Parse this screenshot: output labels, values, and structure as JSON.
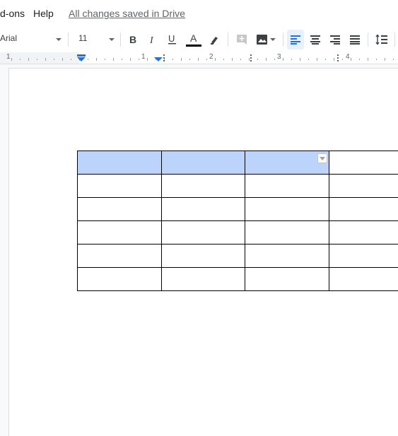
{
  "menu": {
    "items": [
      "d-ons",
      "Help"
    ],
    "save_status": "All changes saved in Drive"
  },
  "toolbar": {
    "font_name": "Arial",
    "font_size": "11",
    "text_color": "#000000",
    "icons": [
      "bold-icon",
      "italic-icon",
      "underline-icon",
      "text-color-icon",
      "highlight-icon",
      "insert-comment-icon",
      "insert-image-icon",
      "align-left-icon",
      "align-center-icon",
      "align-right-icon",
      "justify-icon",
      "line-spacing-icon"
    ]
  },
  "ruler": {
    "numbers": [
      "1",
      "1",
      "2",
      "3",
      "4"
    ]
  },
  "table": {
    "rows": 6,
    "cols": 4,
    "highlight_color": "#bcd4fb",
    "cells": [
      [
        "",
        "",
        "",
        ""
      ],
      [
        "",
        "",
        "",
        ""
      ],
      [
        "",
        "",
        "",
        ""
      ],
      [
        "",
        "",
        "",
        ""
      ],
      [
        "",
        "",
        "",
        ""
      ],
      [
        "",
        "",
        "",
        ""
      ]
    ]
  }
}
